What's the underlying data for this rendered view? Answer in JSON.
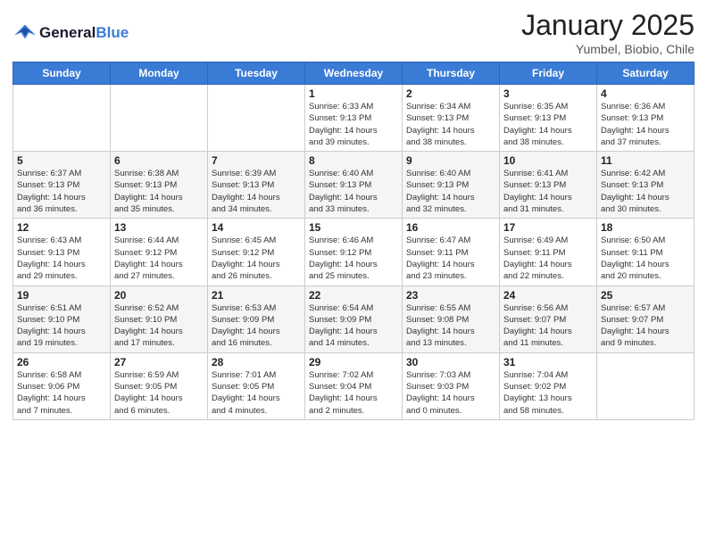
{
  "header": {
    "logo_line1": "General",
    "logo_line2": "Blue",
    "title": "January 2025",
    "subtitle": "Yumbel, Biobio, Chile"
  },
  "weekdays": [
    "Sunday",
    "Monday",
    "Tuesday",
    "Wednesday",
    "Thursday",
    "Friday",
    "Saturday"
  ],
  "weeks": [
    [
      {
        "day": "",
        "info": ""
      },
      {
        "day": "",
        "info": ""
      },
      {
        "day": "",
        "info": ""
      },
      {
        "day": "1",
        "info": "Sunrise: 6:33 AM\nSunset: 9:13 PM\nDaylight: 14 hours\nand 39 minutes."
      },
      {
        "day": "2",
        "info": "Sunrise: 6:34 AM\nSunset: 9:13 PM\nDaylight: 14 hours\nand 38 minutes."
      },
      {
        "day": "3",
        "info": "Sunrise: 6:35 AM\nSunset: 9:13 PM\nDaylight: 14 hours\nand 38 minutes."
      },
      {
        "day": "4",
        "info": "Sunrise: 6:36 AM\nSunset: 9:13 PM\nDaylight: 14 hours\nand 37 minutes."
      }
    ],
    [
      {
        "day": "5",
        "info": "Sunrise: 6:37 AM\nSunset: 9:13 PM\nDaylight: 14 hours\nand 36 minutes."
      },
      {
        "day": "6",
        "info": "Sunrise: 6:38 AM\nSunset: 9:13 PM\nDaylight: 14 hours\nand 35 minutes."
      },
      {
        "day": "7",
        "info": "Sunrise: 6:39 AM\nSunset: 9:13 PM\nDaylight: 14 hours\nand 34 minutes."
      },
      {
        "day": "8",
        "info": "Sunrise: 6:40 AM\nSunset: 9:13 PM\nDaylight: 14 hours\nand 33 minutes."
      },
      {
        "day": "9",
        "info": "Sunrise: 6:40 AM\nSunset: 9:13 PM\nDaylight: 14 hours\nand 32 minutes."
      },
      {
        "day": "10",
        "info": "Sunrise: 6:41 AM\nSunset: 9:13 PM\nDaylight: 14 hours\nand 31 minutes."
      },
      {
        "day": "11",
        "info": "Sunrise: 6:42 AM\nSunset: 9:13 PM\nDaylight: 14 hours\nand 30 minutes."
      }
    ],
    [
      {
        "day": "12",
        "info": "Sunrise: 6:43 AM\nSunset: 9:13 PM\nDaylight: 14 hours\nand 29 minutes."
      },
      {
        "day": "13",
        "info": "Sunrise: 6:44 AM\nSunset: 9:12 PM\nDaylight: 14 hours\nand 27 minutes."
      },
      {
        "day": "14",
        "info": "Sunrise: 6:45 AM\nSunset: 9:12 PM\nDaylight: 14 hours\nand 26 minutes."
      },
      {
        "day": "15",
        "info": "Sunrise: 6:46 AM\nSunset: 9:12 PM\nDaylight: 14 hours\nand 25 minutes."
      },
      {
        "day": "16",
        "info": "Sunrise: 6:47 AM\nSunset: 9:11 PM\nDaylight: 14 hours\nand 23 minutes."
      },
      {
        "day": "17",
        "info": "Sunrise: 6:49 AM\nSunset: 9:11 PM\nDaylight: 14 hours\nand 22 minutes."
      },
      {
        "day": "18",
        "info": "Sunrise: 6:50 AM\nSunset: 9:11 PM\nDaylight: 14 hours\nand 20 minutes."
      }
    ],
    [
      {
        "day": "19",
        "info": "Sunrise: 6:51 AM\nSunset: 9:10 PM\nDaylight: 14 hours\nand 19 minutes."
      },
      {
        "day": "20",
        "info": "Sunrise: 6:52 AM\nSunset: 9:10 PM\nDaylight: 14 hours\nand 17 minutes."
      },
      {
        "day": "21",
        "info": "Sunrise: 6:53 AM\nSunset: 9:09 PM\nDaylight: 14 hours\nand 16 minutes."
      },
      {
        "day": "22",
        "info": "Sunrise: 6:54 AM\nSunset: 9:09 PM\nDaylight: 14 hours\nand 14 minutes."
      },
      {
        "day": "23",
        "info": "Sunrise: 6:55 AM\nSunset: 9:08 PM\nDaylight: 14 hours\nand 13 minutes."
      },
      {
        "day": "24",
        "info": "Sunrise: 6:56 AM\nSunset: 9:07 PM\nDaylight: 14 hours\nand 11 minutes."
      },
      {
        "day": "25",
        "info": "Sunrise: 6:57 AM\nSunset: 9:07 PM\nDaylight: 14 hours\nand 9 minutes."
      }
    ],
    [
      {
        "day": "26",
        "info": "Sunrise: 6:58 AM\nSunset: 9:06 PM\nDaylight: 14 hours\nand 7 minutes."
      },
      {
        "day": "27",
        "info": "Sunrise: 6:59 AM\nSunset: 9:05 PM\nDaylight: 14 hours\nand 6 minutes."
      },
      {
        "day": "28",
        "info": "Sunrise: 7:01 AM\nSunset: 9:05 PM\nDaylight: 14 hours\nand 4 minutes."
      },
      {
        "day": "29",
        "info": "Sunrise: 7:02 AM\nSunset: 9:04 PM\nDaylight: 14 hours\nand 2 minutes."
      },
      {
        "day": "30",
        "info": "Sunrise: 7:03 AM\nSunset: 9:03 PM\nDaylight: 14 hours\nand 0 minutes."
      },
      {
        "day": "31",
        "info": "Sunrise: 7:04 AM\nSunset: 9:02 PM\nDaylight: 13 hours\nand 58 minutes."
      },
      {
        "day": "",
        "info": ""
      }
    ]
  ]
}
